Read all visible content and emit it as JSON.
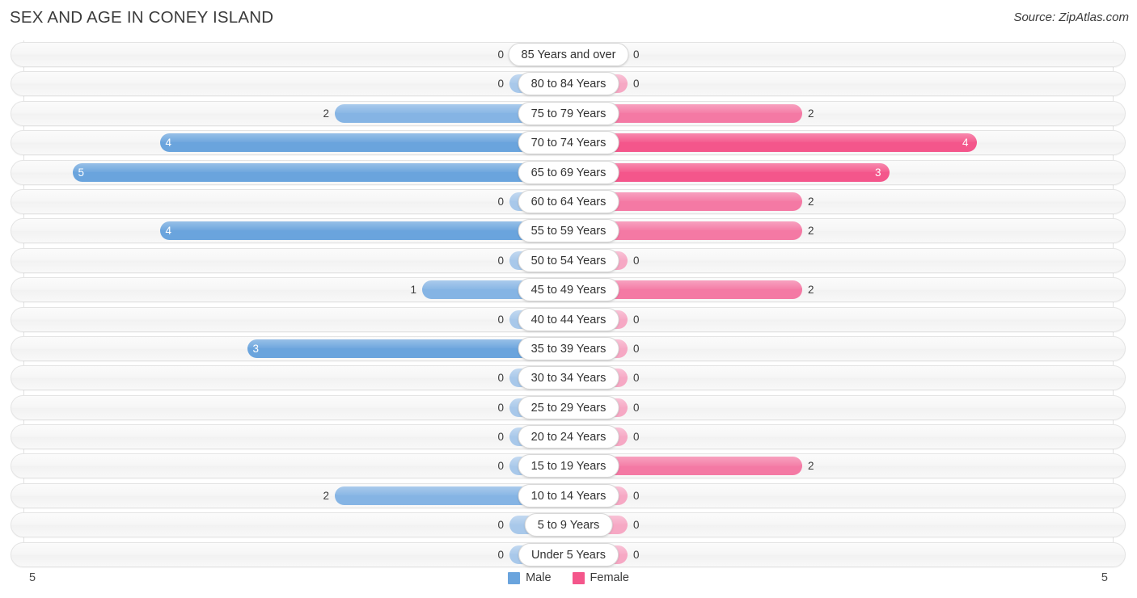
{
  "header": {
    "title": "SEX AND AGE IN CONEY ISLAND",
    "source": "Source: ZipAtlas.com"
  },
  "legend": {
    "male_label": "Male",
    "female_label": "Female"
  },
  "axis": {
    "left_label": "5",
    "right_label": "5"
  },
  "colors": {
    "male": "#6aa4dd",
    "male_zero": "#a8c8ea",
    "female": "#f4568b",
    "female_zero": "#f6a8c4",
    "male_mid": "#85b4e4",
    "female_mid": "#f479a4"
  },
  "chart_data": {
    "type": "bar",
    "subtype": "population-pyramid",
    "title": "SEX AND AGE IN CONEY ISLAND",
    "xlabel": "",
    "ylabel": "",
    "xlim": [
      5,
      5
    ],
    "grid": true,
    "legend_position": "bottom-center",
    "categories": [
      "85 Years and over",
      "80 to 84 Years",
      "75 to 79 Years",
      "70 to 74 Years",
      "65 to 69 Years",
      "60 to 64 Years",
      "55 to 59 Years",
      "50 to 54 Years",
      "45 to 49 Years",
      "40 to 44 Years",
      "35 to 39 Years",
      "30 to 34 Years",
      "25 to 29 Years",
      "20 to 24 Years",
      "15 to 19 Years",
      "10 to 14 Years",
      "5 to 9 Years",
      "Under 5 Years"
    ],
    "series": [
      {
        "name": "Male",
        "values": [
          0,
          0,
          2,
          4,
          5,
          0,
          4,
          0,
          1,
          0,
          3,
          0,
          0,
          0,
          0,
          2,
          0,
          0
        ]
      },
      {
        "name": "Female",
        "values": [
          0,
          0,
          2,
          4,
          3,
          2,
          2,
          0,
          2,
          0,
          0,
          0,
          0,
          0,
          2,
          0,
          0,
          0
        ]
      }
    ]
  },
  "rows": [
    {
      "age": "85 Years and over",
      "male": "0",
      "female": "0"
    },
    {
      "age": "80 to 84 Years",
      "male": "0",
      "female": "0"
    },
    {
      "age": "75 to 79 Years",
      "male": "2",
      "female": "2"
    },
    {
      "age": "70 to 74 Years",
      "male": "4",
      "female": "4"
    },
    {
      "age": "65 to 69 Years",
      "male": "5",
      "female": "3"
    },
    {
      "age": "60 to 64 Years",
      "male": "0",
      "female": "2"
    },
    {
      "age": "55 to 59 Years",
      "male": "4",
      "female": "2"
    },
    {
      "age": "50 to 54 Years",
      "male": "0",
      "female": "0"
    },
    {
      "age": "45 to 49 Years",
      "male": "1",
      "female": "2"
    },
    {
      "age": "40 to 44 Years",
      "male": "0",
      "female": "0"
    },
    {
      "age": "35 to 39 Years",
      "male": "3",
      "female": "0"
    },
    {
      "age": "30 to 34 Years",
      "male": "0",
      "female": "0"
    },
    {
      "age": "25 to 29 Years",
      "male": "0",
      "female": "0"
    },
    {
      "age": "20 to 24 Years",
      "male": "0",
      "female": "0"
    },
    {
      "age": "15 to 19 Years",
      "male": "0",
      "female": "2"
    },
    {
      "age": "10 to 14 Years",
      "male": "2",
      "female": "0"
    },
    {
      "age": "5 to 9 Years",
      "male": "0",
      "female": "0"
    },
    {
      "age": "Under 5 Years",
      "male": "0",
      "female": "0"
    }
  ]
}
